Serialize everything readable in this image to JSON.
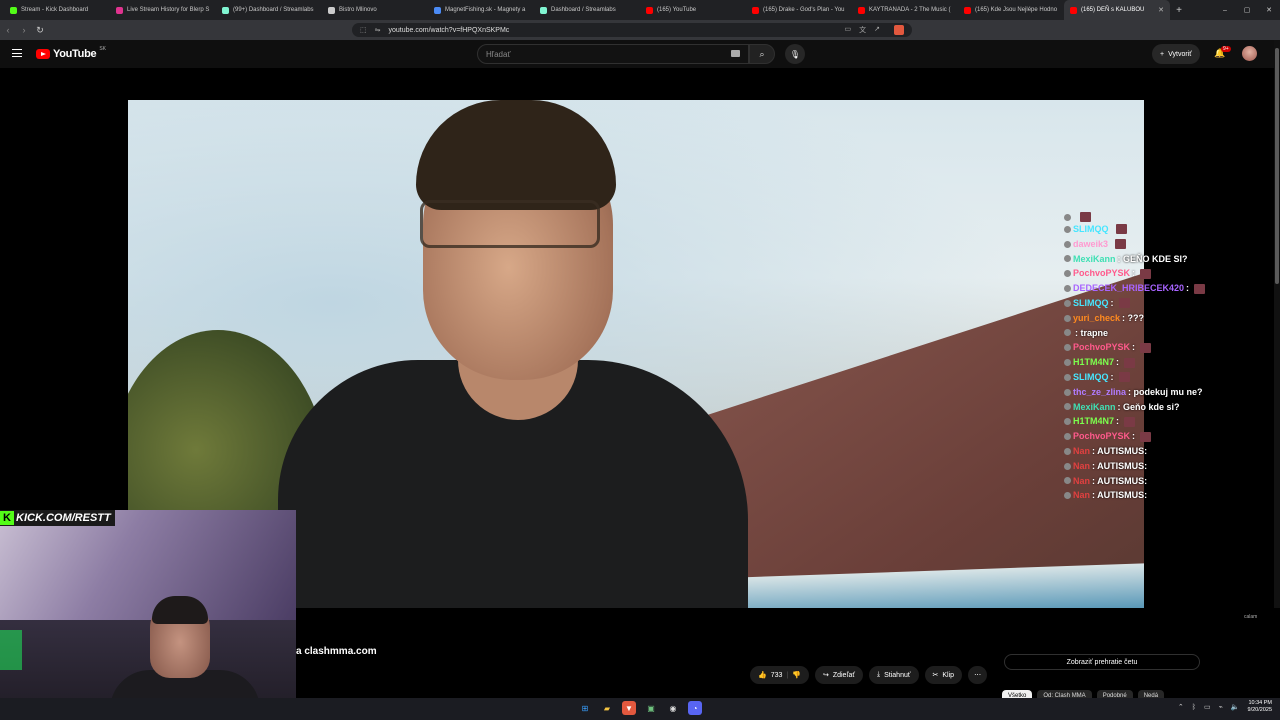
{
  "browser": {
    "tabs": [
      {
        "label": "Stream - Kick Dashboard",
        "color": "#53fc18",
        "active": false
      },
      {
        "label": "Live Stream History for Blerp S",
        "color": "#e0338f",
        "active": false
      },
      {
        "label": "(99+) Dashboard / Streamlabs",
        "color": "#80f5d2",
        "active": false
      },
      {
        "label": "Bistro Mlinovo",
        "color": "#cccccc",
        "active": false
      },
      {
        "label": "MagnetFishing.sk - Magnety a",
        "color": "#4b8bf5",
        "active": false
      },
      {
        "label": "Dashboard / Streamlabs",
        "color": "#80f5d2",
        "active": false
      },
      {
        "label": "(165) YouTube",
        "color": "#ff0000",
        "active": false
      },
      {
        "label": "(165) Drake - God's Plan - You",
        "color": "#ff0000",
        "active": false
      },
      {
        "label": "KAYTRANADA - 2 The Music (",
        "color": "#ff0000",
        "active": false
      },
      {
        "label": "(165) Kde Jsou Nejlépe Hodno",
        "color": "#ff0000",
        "active": false
      },
      {
        "label": "(165) DEŇ s KALUBOU",
        "color": "#ff0000",
        "active": true
      }
    ],
    "url": "youtube.com/watch?v=fHPQXnSKPMc",
    "new_tab": "+"
  },
  "youtube": {
    "logo_text": "YouTube",
    "region": "SK",
    "search_placeholder": "Hľadať",
    "create_label": "Vytvoriť",
    "notif_badge": "9+"
  },
  "overlay": {
    "kick_text": "KICK.COM/RESTT",
    "kick_letter": "K",
    "chat": [
      {
        "user": "",
        "color": "#9bf00b",
        "text": ""
      },
      {
        "user": "SLIMQQ",
        "color": "#46e6ff",
        "text": ""
      },
      {
        "user": "daweik3",
        "color": "#ff9ad0",
        "text": ""
      },
      {
        "user": "MexiKann",
        "color": "#3fe0b4",
        "text": ": GEŇO KDE SI?"
      },
      {
        "user": "PochvoPYSK",
        "color": "#ff5a8c",
        "text": ":"
      },
      {
        "user": "DEDECEK_HRIBECEK420",
        "color": "#a864ff",
        "text": ":"
      },
      {
        "user": "SLIMQQ",
        "color": "#46e6ff",
        "text": ":"
      },
      {
        "user": "yuri_check",
        "color": "#ff8a1f",
        "text": ": ???"
      },
      {
        "user": "",
        "color": "#e0405a",
        "text": ": trapne"
      },
      {
        "user": "PochvoPYSK",
        "color": "#ff5a8c",
        "text": ":"
      },
      {
        "user": "H1TM4N7",
        "color": "#7cff4e",
        "text": ":"
      },
      {
        "user": "SLIMQQ",
        "color": "#46e6ff",
        "text": ":"
      },
      {
        "user": "thc_ze_zlina",
        "color": "#b07cff",
        "text": ": podekuj mu ne?"
      },
      {
        "user": "MexiKann",
        "color": "#3fe0b4",
        "text": ": Geňo kde si?"
      },
      {
        "user": "H1TM4N7",
        "color": "#7cff4e",
        "text": ":"
      },
      {
        "user": "PochvoPYSK",
        "color": "#ff5a8c",
        "text": ":"
      },
      {
        "user": "Nan",
        "color": "#e04040",
        "text": ": AUTISMUS:"
      },
      {
        "user": "Nan",
        "color": "#e04040",
        "text": ": AUTISMUS:"
      },
      {
        "user": "Nan",
        "color": "#e04040",
        "text": ": AUTISMUS:"
      },
      {
        "user": "Nan",
        "color": "#e04040",
        "text": ": AUTISMUS:"
      }
    ]
  },
  "video": {
    "description_fragment": "a clashmma.com",
    "watermark": "calam",
    "likes": "733",
    "share_label": "Zdieľať",
    "download_label": "Stiahnuť",
    "clip_label": "Klip",
    "more_label": "⋯",
    "chat_replay_label": "Zobraziť prehratie četu",
    "chips": [
      {
        "label": "Všetko",
        "on": true
      },
      {
        "label": "Od: Clash MMA",
        "on": false
      },
      {
        "label": "Podobné",
        "on": false
      },
      {
        "label": "Nedá",
        "on": false
      }
    ]
  },
  "taskbar": {
    "time": "10:34 PM",
    "date": "9/20/2025"
  }
}
